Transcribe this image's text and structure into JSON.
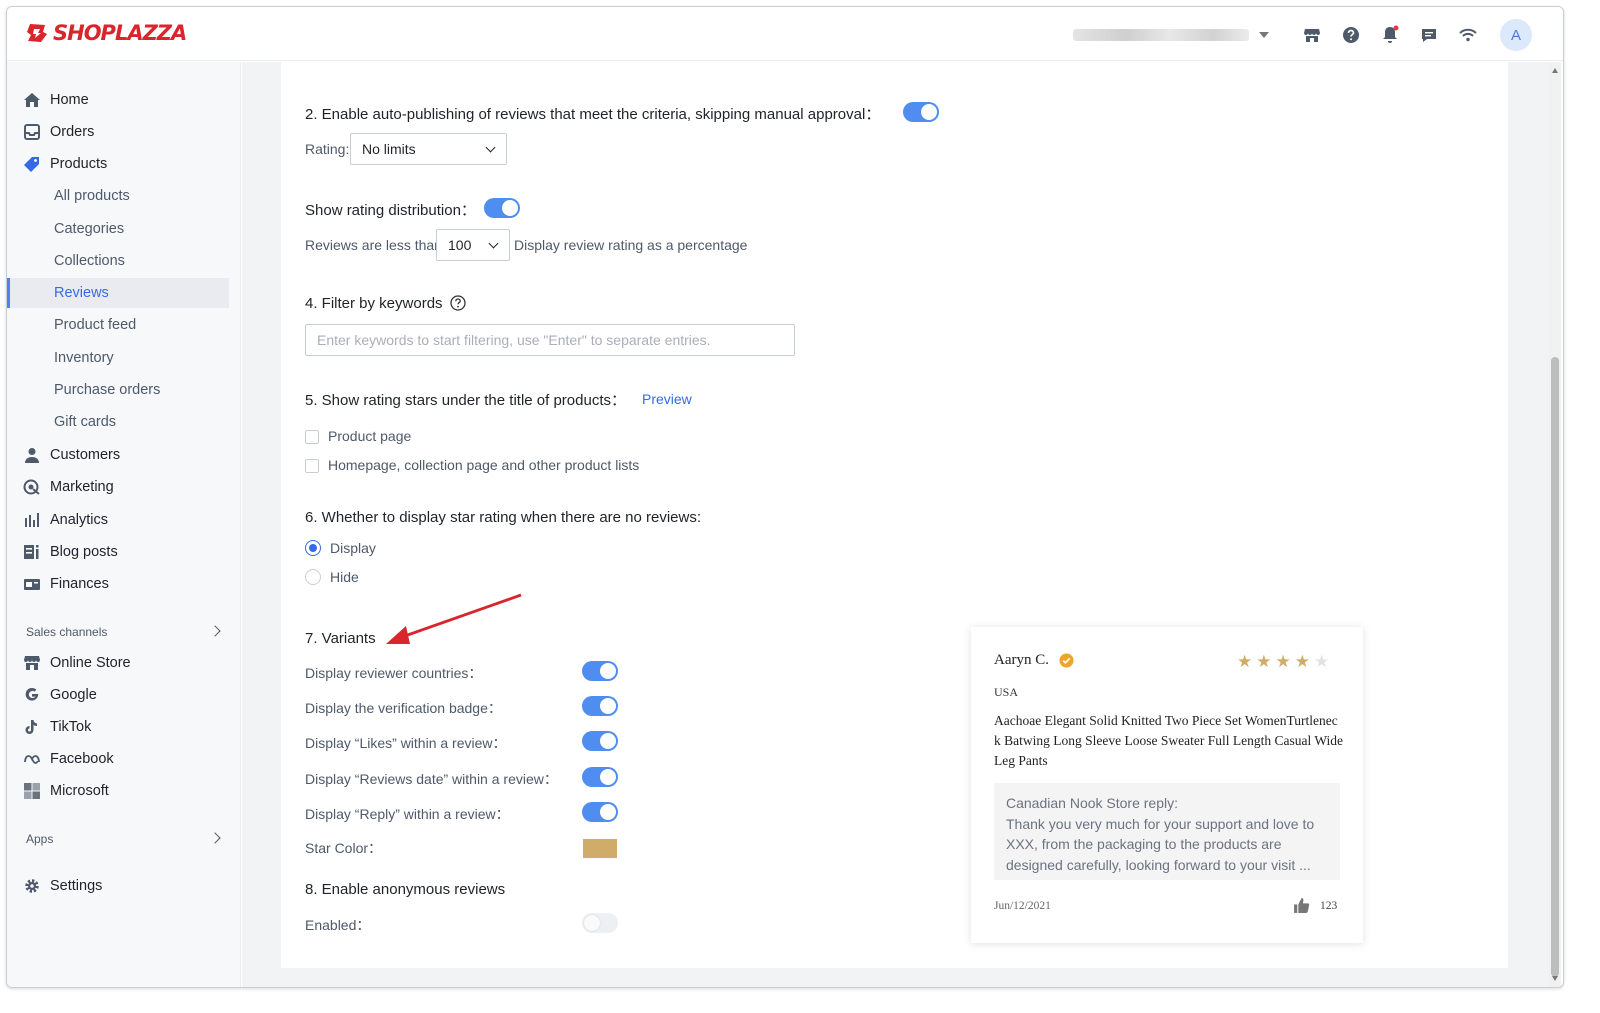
{
  "brand": {
    "name": "SHOPLAZZA",
    "color": "#d8262c"
  },
  "topbar": {
    "icons": [
      "store-icon",
      "help-icon",
      "bell-icon",
      "chat-icon",
      "wifi-icon"
    ],
    "avatar": "A"
  },
  "sidebar": {
    "items": [
      {
        "label": "Home",
        "icon": "home-icon"
      },
      {
        "label": "Orders",
        "icon": "orders-icon"
      },
      {
        "label": "Products",
        "icon": "tag-icon"
      }
    ],
    "product_sub": [
      {
        "label": "All products"
      },
      {
        "label": "Categories"
      },
      {
        "label": "Collections"
      },
      {
        "label": "Reviews",
        "active": true
      },
      {
        "label": "Product feed"
      },
      {
        "label": "Inventory"
      },
      {
        "label": "Purchase orders"
      },
      {
        "label": "Gift cards"
      }
    ],
    "more_items": [
      {
        "label": "Customers",
        "icon": "user-icon"
      },
      {
        "label": "Marketing",
        "icon": "marketing-icon"
      },
      {
        "label": "Analytics",
        "icon": "analytics-icon"
      },
      {
        "label": "Blog posts",
        "icon": "blog-icon"
      },
      {
        "label": "Finances",
        "icon": "finances-icon"
      }
    ],
    "sales_channels_label": "Sales channels",
    "channels": [
      {
        "label": "Online Store",
        "icon": "store-icon"
      },
      {
        "label": "Google",
        "icon": "google-icon"
      },
      {
        "label": "TikTok",
        "icon": "tiktok-icon"
      },
      {
        "label": "Facebook",
        "icon": "meta-icon"
      },
      {
        "label": "Microsoft",
        "icon": "microsoft-icon"
      }
    ],
    "apps_label": "Apps",
    "settings_label": "Settings"
  },
  "settings": {
    "auto_publish": {
      "label": "2. Enable auto-publishing of reviews that meet the criteria, skipping manual approval：",
      "enabled": true,
      "rating_label": "Rating:",
      "rating_value": "No limits"
    },
    "distribution": {
      "label": "Show rating distribution：",
      "enabled": true,
      "prefix": "Reviews are less than",
      "value": "100",
      "suffix": "Display review rating as a percentage"
    },
    "filter": {
      "label": "4. Filter by keywords",
      "placeholder": "Enter keywords to start filtering, use \"Enter\" to separate entries."
    },
    "stars_under_title": {
      "label": "5. Show rating stars under the title of products：",
      "preview": "Preview",
      "options": [
        "Product page",
        "Homepage, collection page and other product lists"
      ]
    },
    "no_reviews": {
      "label": "6. Whether to display star rating when there are no reviews:",
      "options": [
        "Display",
        "Hide"
      ],
      "selected": "Display"
    },
    "variants": {
      "label": "7. Variants",
      "rows": [
        {
          "label": "Display reviewer countries：",
          "enabled": true
        },
        {
          "label": "Display the verification badge：",
          "enabled": true
        },
        {
          "label": "Display “Likes” within a review：",
          "enabled": true
        },
        {
          "label": "Display “Reviews date” within a review：",
          "enabled": true
        },
        {
          "label": "Display “Reply” within a review：",
          "enabled": true
        }
      ],
      "star_color_label": "Star Color：",
      "star_color": "#cfac68"
    },
    "anonymous": {
      "label": "8. Enable anonymous reviews",
      "enabled_label": "Enabled：",
      "enabled": false
    }
  },
  "review_preview": {
    "name": "Aaryn C.",
    "country": "USA",
    "rating": 4,
    "max_rating": 5,
    "title": "Aachoae Elegant Solid Knitted Two Piece Set WomenTurtleneck Batwing Long Sleeve Loose Sweater Full  Length Casual Wide Leg Pants",
    "reply_header": "Canadian Nook Store reply:",
    "reply_text": "Thank you very much for your support and love to XXX, from the packaging to the products are designed carefully, looking forward to your visit ...",
    "date": "Jun/12/2021",
    "likes": "123"
  },
  "colors": {
    "accent": "#356ae6",
    "toggle_on": "#4f8ef0",
    "annotation_arrow": "#d8262c"
  }
}
